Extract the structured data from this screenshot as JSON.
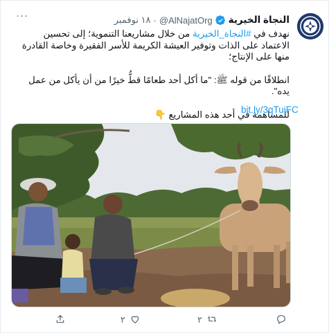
{
  "account": {
    "name": "النجاة الخيرية",
    "handle": "@AlNajatOrg",
    "separator": "·",
    "date": "١٨ نوفمبر",
    "avatar_icon": "najat-logo-icon",
    "verified_icon": "verified-badge-icon"
  },
  "tweet": {
    "line1_prefix": "نهدف في ",
    "line1_hashtag": "#النجاة_الخيرية",
    "line1_suffix": " من خلال مشاريعنا التنموية؛ إلى تحسين الاعتماد على الذات وتوفير العيشة الكريمة للأسر الفقيرة وخاصة القادرة منها على الإنتاج؛",
    "line2": "انطلاقًا من قوله ﷺ: \"ما أكل أحد طعامًا قطُّ خيرًا من أن يأكل من عمل يده\".",
    "line3": "للمساهمة في أحد هذه المشاريع 👇",
    "link": "bit.ly/3qTuiFC"
  },
  "photo": {
    "alt_icon": "tweet-photo"
  },
  "actions": {
    "reply_count": "",
    "retweet_count": "٢",
    "like_count": "٢",
    "share_count": ""
  },
  "colors": {
    "link": "#1d9bf0",
    "muted": "#536471",
    "avatar_bg": "#1f3a6b"
  }
}
